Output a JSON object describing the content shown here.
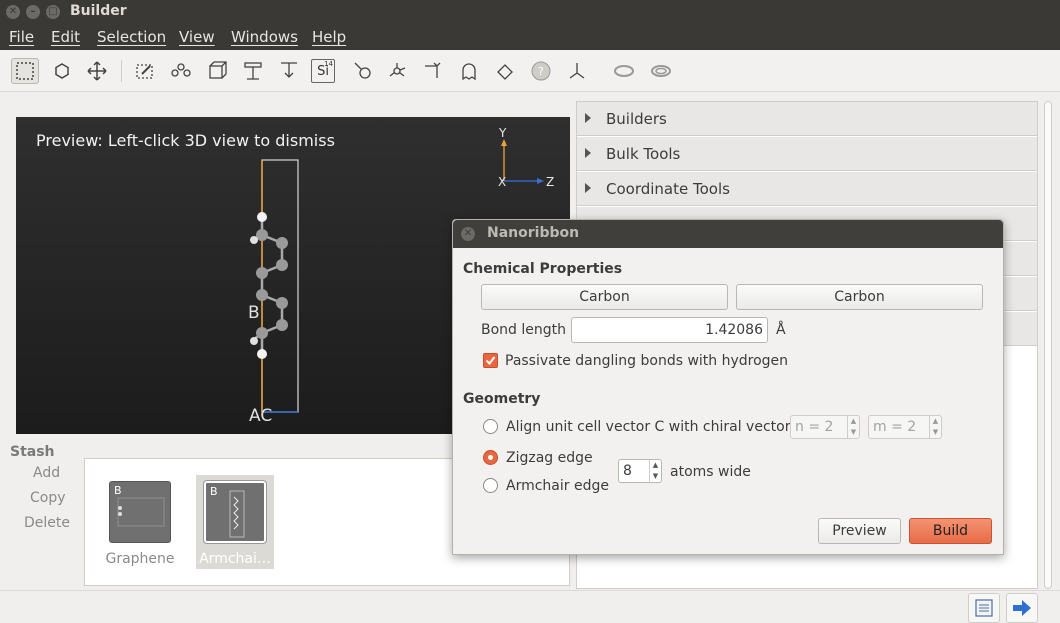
{
  "window": {
    "title": "Builder"
  },
  "menu": [
    "File",
    "Edit",
    "Selection",
    "View",
    "Windows",
    "Help"
  ],
  "toolbar": {
    "icons": [
      "select-rectangle-icon",
      "select-atom-icon",
      "move-icon",
      "rubber-band-icon",
      "bond-icon",
      "unit-cell-icon",
      "split-icon",
      "merge-icon",
      "element-icon",
      "hydrogen-icon",
      "molecule-icon",
      "transform-icon",
      "ghost-icon",
      "rotate-icon",
      "help-icon",
      "axes-icon",
      "ring-icon",
      "loop-icon"
    ],
    "element_symbol": "Si",
    "element_number": "14"
  },
  "preview": {
    "label": "Preview: Left-click 3D view to dismiss",
    "axis_y": "Y",
    "axis_x": "X",
    "axis_z": "Z",
    "atom_label_b": "B",
    "atom_label_ac": "AC"
  },
  "stash": {
    "title": "Stash",
    "actions": [
      "Add",
      "Copy",
      "Delete"
    ],
    "items": [
      {
        "name": "Graphene",
        "badge": "B"
      },
      {
        "name": "Armchai…",
        "badge": "B"
      }
    ]
  },
  "panel": {
    "sections": [
      "Builders",
      "Bulk Tools",
      "Coordinate Tools"
    ]
  },
  "dialog": {
    "title": "Nanoribbon",
    "chemical_title": "Chemical Properties",
    "element1": "Carbon",
    "element2": "Carbon",
    "bond_label": "Bond length",
    "bond_value": "1.42086",
    "bond_unit": "Å",
    "passivate_label": "Passivate dangling bonds with hydrogen",
    "passivate_checked": true,
    "geometry_title": "Geometry",
    "align_label": "Align unit cell vector C with chiral vector",
    "n_value": "n = 2",
    "m_value": "m = 2",
    "zigzag_label": "Zigzag edge",
    "armchair_label": "Armchair edge",
    "atoms_value": "8",
    "atoms_label": "atoms wide",
    "selected_edge": "zigzag",
    "preview_button": "Preview",
    "build_button": "Build"
  },
  "colors": {
    "accent": "#e9673f",
    "titlebar": "#3a3935",
    "bond_orange": "#e8a33c",
    "axis_blue": "#3b6fd6"
  }
}
